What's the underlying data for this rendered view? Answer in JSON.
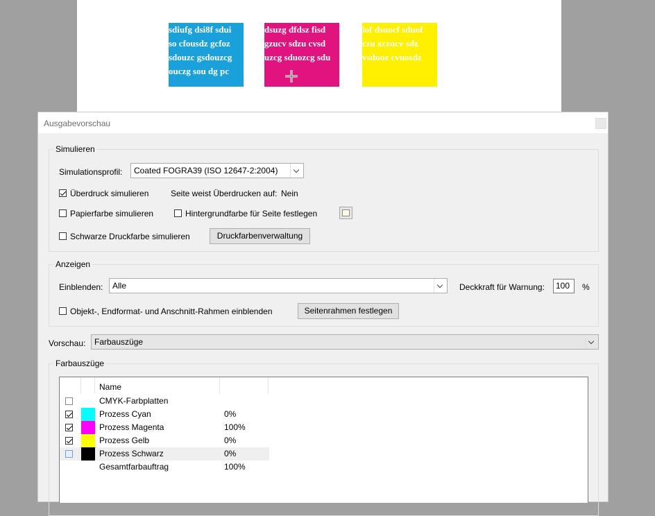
{
  "document": {
    "cyan_box_lines": [
      "sdiufg dsi8f sdui",
      "so cfousdz gcfoz",
      "sdouzc gsdouzcg",
      "ouczg sou dg pc"
    ],
    "magenta_box_lines": [
      "dsuzg dfdsz fisd",
      "gzucv sdzu cvsd",
      "uzcg sduozcg sdu",
      ""
    ],
    "yellow_box_lines": [
      "iof dsuocf sduof",
      "czu  xczucv sdz",
      "vsduoz cvuosdz",
      ""
    ],
    "colors": {
      "cyan": "#1aa1dc",
      "magenta": "#e0137f",
      "yellow": "#fff000"
    }
  },
  "dialog": {
    "title": "Ausgabevorschau",
    "simulieren": {
      "legend": "Simulieren",
      "profile_label": "Simulationsprofil:",
      "profile_value": "Coated FOGRA39 (ISO 12647-2:2004)",
      "overprint_label": "Überdruck simulieren",
      "overprint_checked": true,
      "page_overprint_label": "Seite weist Überdrucken auf:",
      "page_overprint_value": "Nein",
      "paper_color_label": "Papierfarbe simulieren",
      "bg_color_label": "Hintergrundfarbe für Seite festlegen",
      "black_ink_label": "Schwarze Druckfarbe simulieren",
      "ink_manager_button": "Druckfarbenverwaltung"
    },
    "anzeigen": {
      "legend": "Anzeigen",
      "show_label": "Einblenden:",
      "show_value": "Alle",
      "opacity_label": "Deckkraft für Warnung:",
      "opacity_value": "100",
      "opacity_unit": "%",
      "frames_label": "Objekt-, Endformat- und Anschnitt-Rahmen einblenden",
      "page_frames_button": "Seitenrahmen festlegen"
    },
    "preview_label": "Vorschau:",
    "preview_value": "Farbauszüge",
    "separations": {
      "legend": "Farbauszüge",
      "header_name": "Name",
      "rows": [
        {
          "name": "CMYK-Farbplatten",
          "pct": "",
          "checked": false,
          "color": ""
        },
        {
          "name": "Prozess Cyan",
          "pct": "0%",
          "checked": true,
          "color": "#00ffff"
        },
        {
          "name": "Prozess Magenta",
          "pct": "100%",
          "checked": true,
          "color": "#ff00ff"
        },
        {
          "name": "Prozess Gelb",
          "pct": "0%",
          "checked": true,
          "color": "#ffff00"
        },
        {
          "name": "Prozess Schwarz",
          "pct": "0%",
          "checked": false,
          "color": "#000000"
        },
        {
          "name": "Gesamtfarbauftrag",
          "pct": "100%",
          "checked": false,
          "color": ""
        }
      ]
    }
  }
}
